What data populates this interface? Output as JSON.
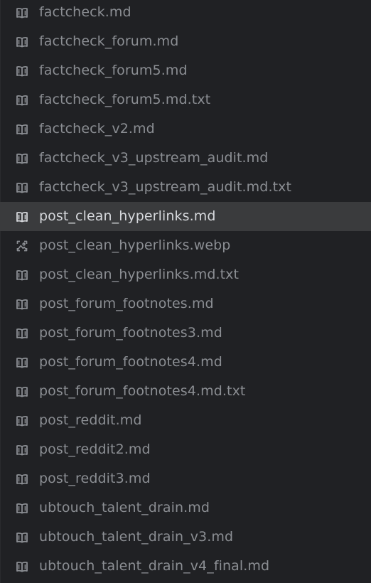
{
  "files": [
    {
      "name": "factcheck.md",
      "icon": "book-icon",
      "selected": false
    },
    {
      "name": "factcheck_forum.md",
      "icon": "book-icon",
      "selected": false
    },
    {
      "name": "factcheck_forum5.md",
      "icon": "book-icon",
      "selected": false
    },
    {
      "name": "factcheck_forum5.md.txt",
      "icon": "book-icon",
      "selected": false
    },
    {
      "name": "factcheck_v2.md",
      "icon": "book-icon",
      "selected": false
    },
    {
      "name": "factcheck_v3_upstream_audit.md",
      "icon": "book-icon",
      "selected": false
    },
    {
      "name": "factcheck_v3_upstream_audit.md.txt",
      "icon": "book-icon",
      "selected": false
    },
    {
      "name": "post_clean_hyperlinks.md",
      "icon": "book-icon",
      "selected": true
    },
    {
      "name": "post_clean_hyperlinks.webp",
      "icon": "image-icon",
      "selected": false
    },
    {
      "name": "post_clean_hyperlinks.md.txt",
      "icon": "book-icon",
      "selected": false
    },
    {
      "name": "post_forum_footnotes.md",
      "icon": "book-icon",
      "selected": false
    },
    {
      "name": "post_forum_footnotes3.md",
      "icon": "book-icon",
      "selected": false
    },
    {
      "name": "post_forum_footnotes4.md",
      "icon": "book-icon",
      "selected": false
    },
    {
      "name": "post_forum_footnotes4.md.txt",
      "icon": "book-icon",
      "selected": false
    },
    {
      "name": "post_reddit.md",
      "icon": "book-icon",
      "selected": false
    },
    {
      "name": "post_reddit2.md",
      "icon": "book-icon",
      "selected": false
    },
    {
      "name": "post_reddit3.md",
      "icon": "book-icon",
      "selected": false
    },
    {
      "name": "ubtouch_talent_drain.md",
      "icon": "book-icon",
      "selected": false
    },
    {
      "name": "ubtouch_talent_drain_v3.md",
      "icon": "book-icon",
      "selected": false
    },
    {
      "name": "ubtouch_talent_drain_v4_final.md",
      "icon": "book-icon",
      "selected": false
    }
  ],
  "colors": {
    "background": "#202124",
    "selected_row": "#3a3b3d",
    "text": "#8b8e93",
    "text_selected": "#d6d8dc",
    "icon": "#8b8e93"
  }
}
